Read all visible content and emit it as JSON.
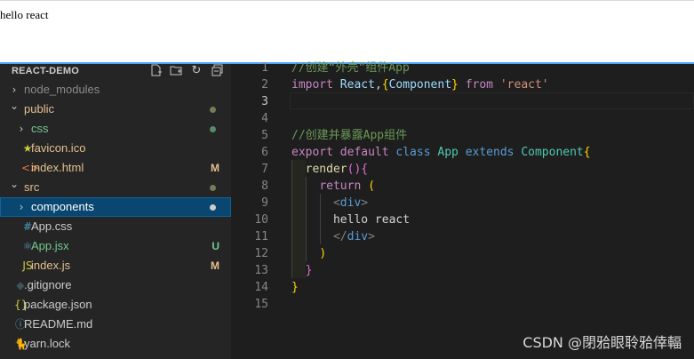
{
  "browser": {
    "content_text": "hello react"
  },
  "explorer": {
    "title": "REACT-DEMO",
    "header_icons": [
      "new-file-icon",
      "new-folder-icon",
      "refresh-icon",
      "collapse-all-icon"
    ],
    "items": [
      {
        "label": "node_modules",
        "type": "folder",
        "expanded": false,
        "indent": 0,
        "color": "#8b8b8b"
      },
      {
        "label": "public",
        "type": "folder",
        "expanded": true,
        "indent": 0,
        "color": "#e2c08d",
        "status": "dot"
      },
      {
        "label": "css",
        "type": "folder",
        "expanded": false,
        "indent": 1,
        "color": "#73c991",
        "status": "dot"
      },
      {
        "label": "favicon.ico",
        "type": "file",
        "icon": "★",
        "icon_color": "#cbcb41",
        "indent": 1,
        "color": "#e2c08d"
      },
      {
        "label": "index.html",
        "type": "file",
        "icon": "<>",
        "icon_color": "#e37933",
        "indent": 1,
        "color": "#e2c08d",
        "status": "M"
      },
      {
        "label": "src",
        "type": "folder",
        "expanded": true,
        "indent": 0,
        "color": "#e2c08d",
        "status": "dot"
      },
      {
        "label": "components",
        "type": "folder",
        "expanded": false,
        "indent": 1,
        "color": "#ffffff",
        "status": "dot",
        "selected": true
      },
      {
        "label": "App.css",
        "type": "file",
        "icon": "#",
        "icon_color": "#519aba",
        "indent": 1,
        "color": "#cccccc"
      },
      {
        "label": "App.jsx",
        "type": "file",
        "icon": "⚛",
        "icon_color": "#519aba",
        "indent": 1,
        "color": "#73c991",
        "status": "U"
      },
      {
        "label": "index.js",
        "type": "file",
        "icon": "JS",
        "icon_color": "#cbcb41",
        "indent": 1,
        "color": "#e2c08d",
        "status": "M"
      },
      {
        "label": ".gitignore",
        "type": "file",
        "icon": "◆",
        "icon_color": "#41535b",
        "indent": 0,
        "color": "#cccccc"
      },
      {
        "label": "package.json",
        "type": "file",
        "icon": "{}",
        "icon_color": "#cbcb41",
        "indent": 0,
        "color": "#cccccc"
      },
      {
        "label": "README.md",
        "type": "file",
        "icon": "ⓘ",
        "icon_color": "#519aba",
        "indent": 0,
        "color": "#cccccc"
      },
      {
        "label": "yarn.lock",
        "type": "file",
        "icon": "🐈",
        "icon_color": "#519aba",
        "indent": 0,
        "color": "#cccccc"
      }
    ]
  },
  "editor": {
    "active_line": 3,
    "lines": [
      [
        [
          "c-comment",
          "//创建“外壳”组件App"
        ]
      ],
      [
        [
          "c-kw",
          "import "
        ],
        [
          "c-var",
          "React"
        ],
        [
          "c-text",
          ","
        ],
        [
          "c-y",
          "{"
        ],
        [
          "c-var",
          "Component"
        ],
        [
          "c-y",
          "}"
        ],
        [
          "c-kw",
          " from "
        ],
        [
          "c-str",
          "'react'"
        ]
      ],
      [],
      [],
      [
        [
          "c-comment",
          "//创建并暴露App组件"
        ]
      ],
      [
        [
          "c-kw",
          "export default "
        ],
        [
          "c-blue",
          "class "
        ],
        [
          "c-type",
          "App "
        ],
        [
          "c-blue",
          "extends "
        ],
        [
          "c-type",
          "Component"
        ],
        [
          "c-y",
          "{"
        ]
      ],
      [
        [
          "c-text",
          "  "
        ],
        [
          "c-fn",
          "render"
        ],
        [
          "c-p",
          "()"
        ],
        [
          "c-p",
          "{"
        ]
      ],
      [
        [
          "c-text",
          "    "
        ],
        [
          "c-kw",
          "return "
        ],
        [
          "c-y",
          "("
        ]
      ],
      [
        [
          "c-text",
          "      "
        ],
        [
          "c-tag",
          "<"
        ],
        [
          "c-tagname",
          "div"
        ],
        [
          "c-tag",
          ">"
        ]
      ],
      [
        [
          "c-text",
          "      hello react"
        ]
      ],
      [
        [
          "c-text",
          "      "
        ],
        [
          "c-tag",
          "</"
        ],
        [
          "c-tagname",
          "div"
        ],
        [
          "c-tag",
          ">"
        ]
      ],
      [
        [
          "c-text",
          "    "
        ],
        [
          "c-y",
          ")"
        ]
      ],
      [
        [
          "c-text",
          "  "
        ],
        [
          "c-p",
          "}"
        ]
      ],
      [
        [
          "c-y",
          "}"
        ]
      ],
      []
    ]
  },
  "watermark": "CSDN @閉𬌗眼聆𬌗倖輻"
}
